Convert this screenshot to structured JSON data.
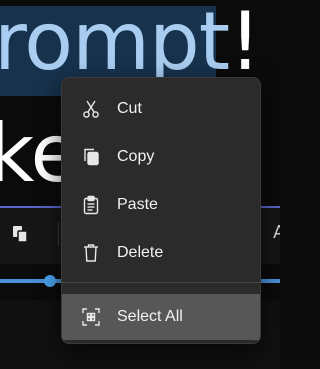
{
  "document": {
    "line1_selected": "ompt",
    "line1_unselected": "!",
    "line1_prefix_selected": "r",
    "line2": "ke"
  },
  "toolbar": {
    "right_letter": "A"
  },
  "context_menu": {
    "items": [
      {
        "label": "Cut",
        "icon": "scissors-icon"
      },
      {
        "label": "Copy",
        "icon": "copy-icon"
      },
      {
        "label": "Paste",
        "icon": "paste-icon"
      },
      {
        "label": "Delete",
        "icon": "trash-icon"
      }
    ],
    "select_all": {
      "label": "Select All",
      "icon": "select-all-icon"
    }
  },
  "colors": {
    "menu_bg": "#2b2b2b",
    "menu_highlight": "#575757",
    "selection_bg": "#17324d",
    "selection_text": "#a9cdf0",
    "accent": "#4aa3ee"
  }
}
